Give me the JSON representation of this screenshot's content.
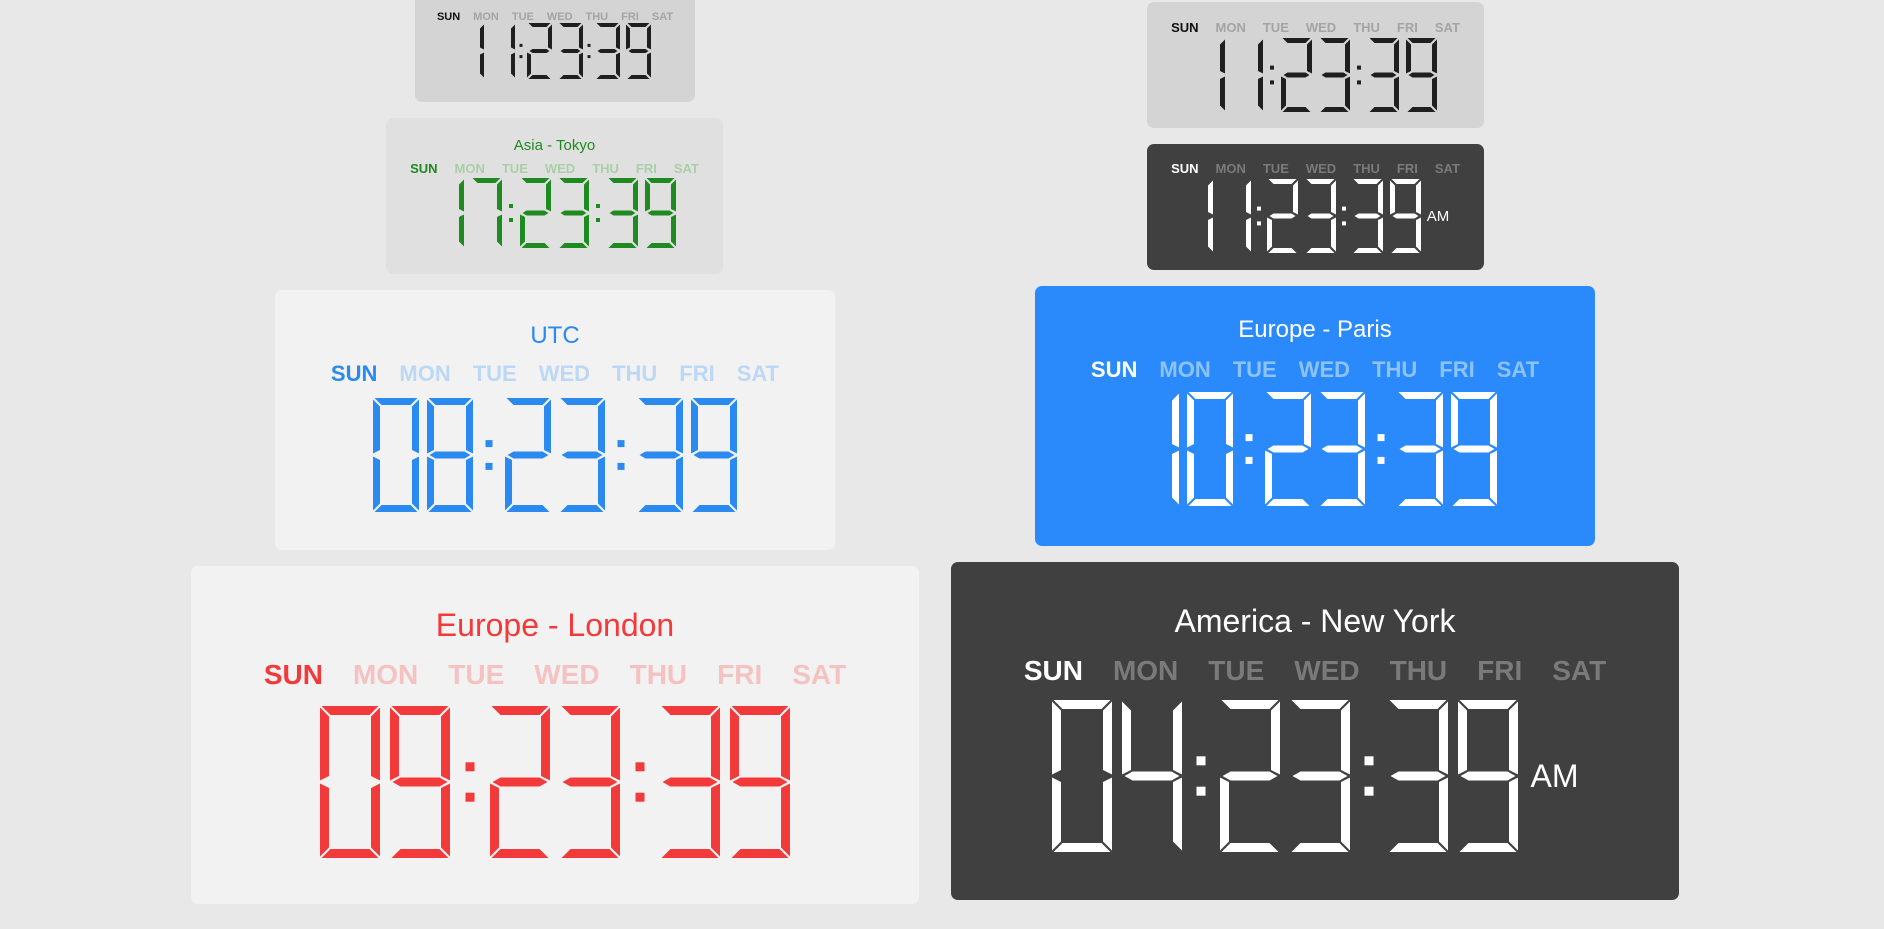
{
  "day_labels": [
    "SUN",
    "MON",
    "TUE",
    "WED",
    "THU",
    "FRI",
    "SAT"
  ],
  "active_day_index": 0,
  "clocks": [
    {
      "id": "top-left-small",
      "title": "",
      "hours": "11",
      "minutes": "23",
      "seconds": "39",
      "ampm": "",
      "colors": {
        "background": "#d4d4d4",
        "digit": "#1f1f1f",
        "active_day": "#111111",
        "inactive_day": "#a4a4a4",
        "title": "#1f1f1f"
      }
    },
    {
      "id": "asia-tokyo",
      "title": "Asia - Tokyo",
      "hours": "17",
      "minutes": "23",
      "seconds": "39",
      "ampm": "",
      "colors": {
        "background": "#e0e0e0",
        "digit": "#1f8a20",
        "active_day": "#1f8a20",
        "inactive_day": "#a8cfa8",
        "title": "#1f8a20"
      }
    },
    {
      "id": "utc",
      "title": "UTC",
      "hours": "08",
      "minutes": "23",
      "seconds": "39",
      "ampm": "",
      "colors": {
        "background": "#f2f2f2",
        "digit": "#2a8af0",
        "active_day": "#2a8af0",
        "inactive_day": "#bcd8f6",
        "title": "#2a8af0"
      }
    },
    {
      "id": "europe-london",
      "title": "Europe - London",
      "hours": "09",
      "minutes": "23",
      "seconds": "39",
      "ampm": "",
      "colors": {
        "background": "#f2f2f2",
        "digit": "#f23a3a",
        "active_day": "#f23a3a",
        "inactive_day": "#f5c2c2",
        "title": "#f23a3a"
      }
    },
    {
      "id": "top-right-small",
      "title": "",
      "hours": "11",
      "minutes": "23",
      "seconds": "39",
      "ampm": "",
      "colors": {
        "background": "#d4d4d4",
        "digit": "#1f1f1f",
        "active_day": "#111111",
        "inactive_day": "#a4a4a4",
        "title": "#1f1f1f"
      }
    },
    {
      "id": "top-right-dark-small",
      "title": "",
      "hours": "11",
      "minutes": "23",
      "seconds": "39",
      "ampm": "AM",
      "colors": {
        "background": "#404040",
        "digit": "#ffffff",
        "active_day": "#ffffff",
        "inactive_day": "#7a7a7a",
        "title": "#ffffff"
      }
    },
    {
      "id": "europe-paris",
      "title": "Europe - Paris",
      "hours": "10",
      "minutes": "23",
      "seconds": "39",
      "ampm": "",
      "colors": {
        "background": "#2a8afc",
        "digit": "#ffffff",
        "active_day": "#ffffff",
        "inactive_day": "#8dc2fb",
        "title": "#ffffff"
      }
    },
    {
      "id": "america-new-york",
      "title": "America - New York",
      "hours": "04",
      "minutes": "23",
      "seconds": "39",
      "ampm": "AM",
      "colors": {
        "background": "#404040",
        "digit": "#ffffff",
        "active_day": "#ffffff",
        "inactive_day": "#7a7a7a",
        "title": "#ffffff"
      }
    }
  ]
}
